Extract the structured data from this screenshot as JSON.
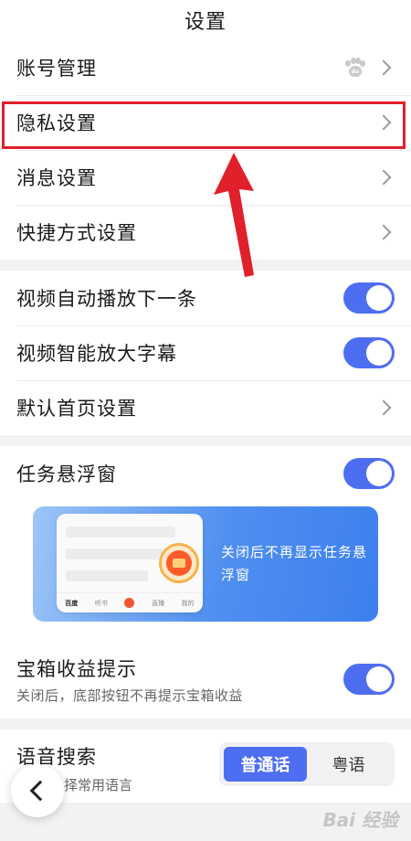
{
  "header": {
    "title": "设置"
  },
  "group1": {
    "items": [
      {
        "label": "账号管理"
      },
      {
        "label": "隐私设置"
      },
      {
        "label": "消息设置"
      },
      {
        "label": "快捷方式设置"
      }
    ]
  },
  "group2": {
    "items": [
      {
        "label": "视频自动播放下一条",
        "toggle": true
      },
      {
        "label": "视频智能放大字幕",
        "toggle": true
      },
      {
        "label": "默认首页设置"
      }
    ]
  },
  "group3": {
    "floating": {
      "label": "任务悬浮窗",
      "toggle": true
    },
    "banner": {
      "text": "关闭后不再显示任务悬浮窗",
      "phone_nav": [
        "百度",
        "听书",
        "直播",
        "我的"
      ]
    },
    "treasure": {
      "label": "宝箱收益提示",
      "sub": "关闭后，底部按钮不再提示宝箱收益",
      "toggle": true
    }
  },
  "group4": {
    "voice": {
      "label": "语音搜索",
      "sub": "择常用语言",
      "options": [
        "普通话",
        "粤语"
      ],
      "selected": "普通话"
    }
  },
  "watermark": "Bai 经验",
  "colors": {
    "accent": "#4e6ef2",
    "highlight": "#e0202a"
  }
}
